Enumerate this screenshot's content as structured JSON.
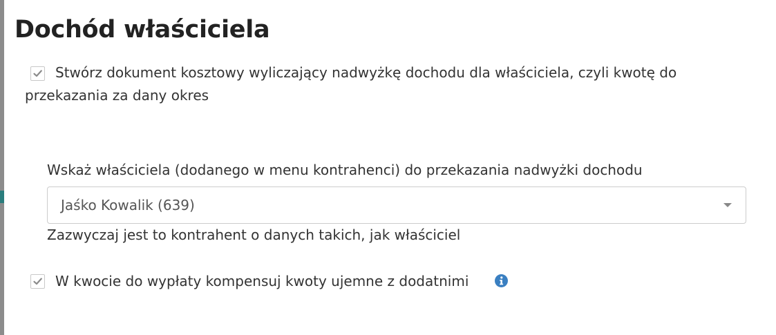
{
  "dialog": {
    "title": "Dochód właściciela"
  },
  "create_cost_document": {
    "checked": true,
    "label_line1": "Stwórz dokument kosztowy wyliczający nadwyżkę dochodu dla właściciela, czyli kwotę do",
    "label_line2": "przekazania za dany okres"
  },
  "owner_select": {
    "label": "Wskaż właściciela (dodanego w menu kontrahenci) do przekazania nadwyżki dochodu",
    "selected_value": "Jaśko Kowalik (639)",
    "hint": "Zazwyczaj jest to kontrahent o danych takich, jak właściciel"
  },
  "compensate_amounts": {
    "checked": true,
    "label": "W kwocie do wypłaty kompensuj kwoty ujemne z dodatnimi"
  },
  "icons": {
    "checkmark": "check-icon",
    "dropdown": "caret-down-icon",
    "info": "info-icon"
  },
  "colors": {
    "checkmark": "#8a8a8a",
    "info": "#3a7fc1",
    "text": "#333333",
    "border": "#cccccc"
  }
}
